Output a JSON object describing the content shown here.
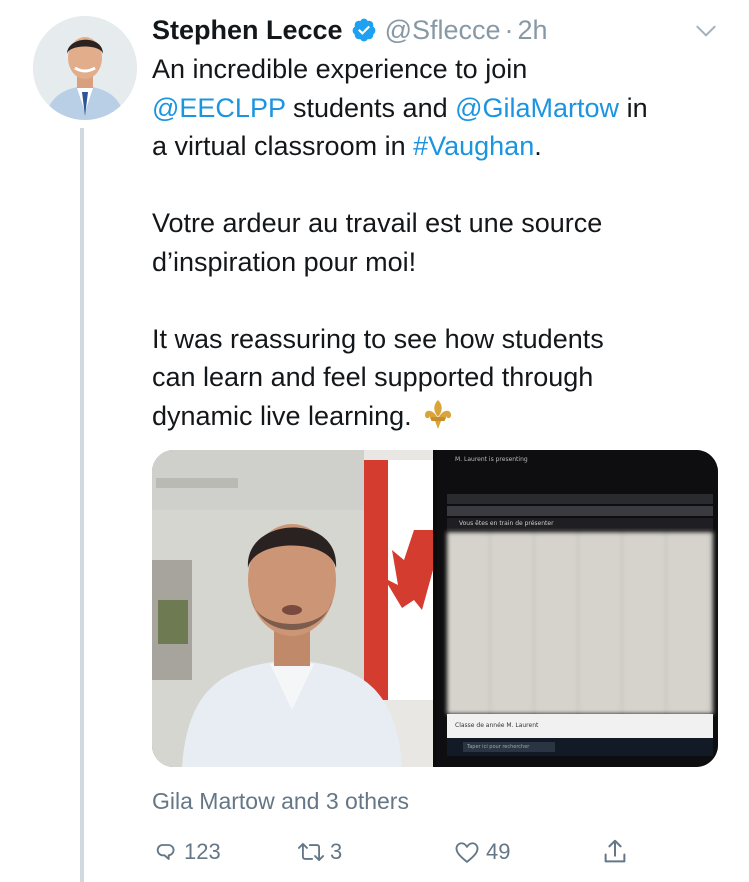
{
  "tweet": {
    "author_name": "Stephen Lecce",
    "handle": "@Sflecce",
    "separator": "·",
    "time": "2h",
    "text_segments": [
      {
        "text": "An incredible experience to join\n",
        "link": false
      },
      {
        "text": "@EECLPP",
        "link": true
      },
      {
        "text": " students and ",
        "link": false
      },
      {
        "text": "@GilaMartow",
        "link": true
      },
      {
        "text": " in\na virtual classroom in ",
        "link": false
      },
      {
        "text": "#Vaughan",
        "link": true
      },
      {
        "text": ".\n\nVotre ardeur au travail est une source\nd’inspiration pour moi!\n\nIt was reassuring to see how students\ncan learn and feel supported through\ndynamic live learning.",
        "link": false
      }
    ],
    "social_context": "Gila Martow and 3 others",
    "media": {
      "screen_presenting": "M. Laurent is presenting",
      "screen_present_notice": "Vous êtes en train de présenter",
      "screen_classroom": "Classe de année M. Laurent",
      "screen_search": "Taper ici pour rechercher"
    }
  },
  "actions": {
    "reply_count": "123",
    "retweet_count": "3",
    "like_count": "49",
    "share_count": ""
  },
  "icons": {
    "verified": "verified-badge-icon",
    "caret": "chevron-down-icon",
    "reply": "reply-icon",
    "retweet": "retweet-icon",
    "like": "heart-icon",
    "share": "share-icon",
    "emoji": "fleur-de-lis-icon"
  },
  "colors": {
    "link": "#1b95e0",
    "verified": "#1da1f2",
    "secondary": "#8899a6",
    "thread_line": "#cfd9de"
  }
}
